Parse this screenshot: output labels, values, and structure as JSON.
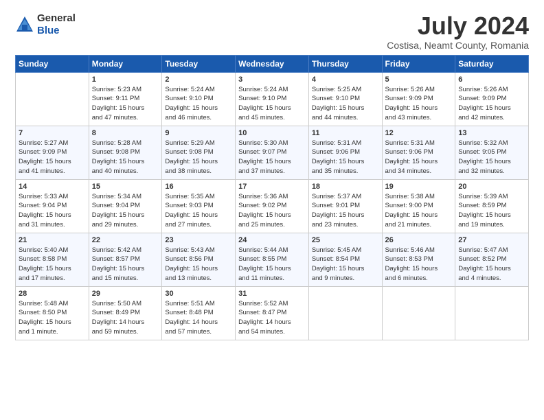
{
  "header": {
    "logo_line1": "General",
    "logo_line2": "Blue",
    "month_title": "July 2024",
    "location": "Costisa, Neamt County, Romania"
  },
  "weekdays": [
    "Sunday",
    "Monday",
    "Tuesday",
    "Wednesday",
    "Thursday",
    "Friday",
    "Saturday"
  ],
  "weeks": [
    [
      {
        "day": "",
        "info": ""
      },
      {
        "day": "1",
        "info": "Sunrise: 5:23 AM\nSunset: 9:11 PM\nDaylight: 15 hours\nand 47 minutes."
      },
      {
        "day": "2",
        "info": "Sunrise: 5:24 AM\nSunset: 9:10 PM\nDaylight: 15 hours\nand 46 minutes."
      },
      {
        "day": "3",
        "info": "Sunrise: 5:24 AM\nSunset: 9:10 PM\nDaylight: 15 hours\nand 45 minutes."
      },
      {
        "day": "4",
        "info": "Sunrise: 5:25 AM\nSunset: 9:10 PM\nDaylight: 15 hours\nand 44 minutes."
      },
      {
        "day": "5",
        "info": "Sunrise: 5:26 AM\nSunset: 9:09 PM\nDaylight: 15 hours\nand 43 minutes."
      },
      {
        "day": "6",
        "info": "Sunrise: 5:26 AM\nSunset: 9:09 PM\nDaylight: 15 hours\nand 42 minutes."
      }
    ],
    [
      {
        "day": "7",
        "info": "Sunrise: 5:27 AM\nSunset: 9:09 PM\nDaylight: 15 hours\nand 41 minutes."
      },
      {
        "day": "8",
        "info": "Sunrise: 5:28 AM\nSunset: 9:08 PM\nDaylight: 15 hours\nand 40 minutes."
      },
      {
        "day": "9",
        "info": "Sunrise: 5:29 AM\nSunset: 9:08 PM\nDaylight: 15 hours\nand 38 minutes."
      },
      {
        "day": "10",
        "info": "Sunrise: 5:30 AM\nSunset: 9:07 PM\nDaylight: 15 hours\nand 37 minutes."
      },
      {
        "day": "11",
        "info": "Sunrise: 5:31 AM\nSunset: 9:06 PM\nDaylight: 15 hours\nand 35 minutes."
      },
      {
        "day": "12",
        "info": "Sunrise: 5:31 AM\nSunset: 9:06 PM\nDaylight: 15 hours\nand 34 minutes."
      },
      {
        "day": "13",
        "info": "Sunrise: 5:32 AM\nSunset: 9:05 PM\nDaylight: 15 hours\nand 32 minutes."
      }
    ],
    [
      {
        "day": "14",
        "info": "Sunrise: 5:33 AM\nSunset: 9:04 PM\nDaylight: 15 hours\nand 31 minutes."
      },
      {
        "day": "15",
        "info": "Sunrise: 5:34 AM\nSunset: 9:04 PM\nDaylight: 15 hours\nand 29 minutes."
      },
      {
        "day": "16",
        "info": "Sunrise: 5:35 AM\nSunset: 9:03 PM\nDaylight: 15 hours\nand 27 minutes."
      },
      {
        "day": "17",
        "info": "Sunrise: 5:36 AM\nSunset: 9:02 PM\nDaylight: 15 hours\nand 25 minutes."
      },
      {
        "day": "18",
        "info": "Sunrise: 5:37 AM\nSunset: 9:01 PM\nDaylight: 15 hours\nand 23 minutes."
      },
      {
        "day": "19",
        "info": "Sunrise: 5:38 AM\nSunset: 9:00 PM\nDaylight: 15 hours\nand 21 minutes."
      },
      {
        "day": "20",
        "info": "Sunrise: 5:39 AM\nSunset: 8:59 PM\nDaylight: 15 hours\nand 19 minutes."
      }
    ],
    [
      {
        "day": "21",
        "info": "Sunrise: 5:40 AM\nSunset: 8:58 PM\nDaylight: 15 hours\nand 17 minutes."
      },
      {
        "day": "22",
        "info": "Sunrise: 5:42 AM\nSunset: 8:57 PM\nDaylight: 15 hours\nand 15 minutes."
      },
      {
        "day": "23",
        "info": "Sunrise: 5:43 AM\nSunset: 8:56 PM\nDaylight: 15 hours\nand 13 minutes."
      },
      {
        "day": "24",
        "info": "Sunrise: 5:44 AM\nSunset: 8:55 PM\nDaylight: 15 hours\nand 11 minutes."
      },
      {
        "day": "25",
        "info": "Sunrise: 5:45 AM\nSunset: 8:54 PM\nDaylight: 15 hours\nand 9 minutes."
      },
      {
        "day": "26",
        "info": "Sunrise: 5:46 AM\nSunset: 8:53 PM\nDaylight: 15 hours\nand 6 minutes."
      },
      {
        "day": "27",
        "info": "Sunrise: 5:47 AM\nSunset: 8:52 PM\nDaylight: 15 hours\nand 4 minutes."
      }
    ],
    [
      {
        "day": "28",
        "info": "Sunrise: 5:48 AM\nSunset: 8:50 PM\nDaylight: 15 hours\nand 1 minute."
      },
      {
        "day": "29",
        "info": "Sunrise: 5:50 AM\nSunset: 8:49 PM\nDaylight: 14 hours\nand 59 minutes."
      },
      {
        "day": "30",
        "info": "Sunrise: 5:51 AM\nSunset: 8:48 PM\nDaylight: 14 hours\nand 57 minutes."
      },
      {
        "day": "31",
        "info": "Sunrise: 5:52 AM\nSunset: 8:47 PM\nDaylight: 14 hours\nand 54 minutes."
      },
      {
        "day": "",
        "info": ""
      },
      {
        "day": "",
        "info": ""
      },
      {
        "day": "",
        "info": ""
      }
    ]
  ]
}
